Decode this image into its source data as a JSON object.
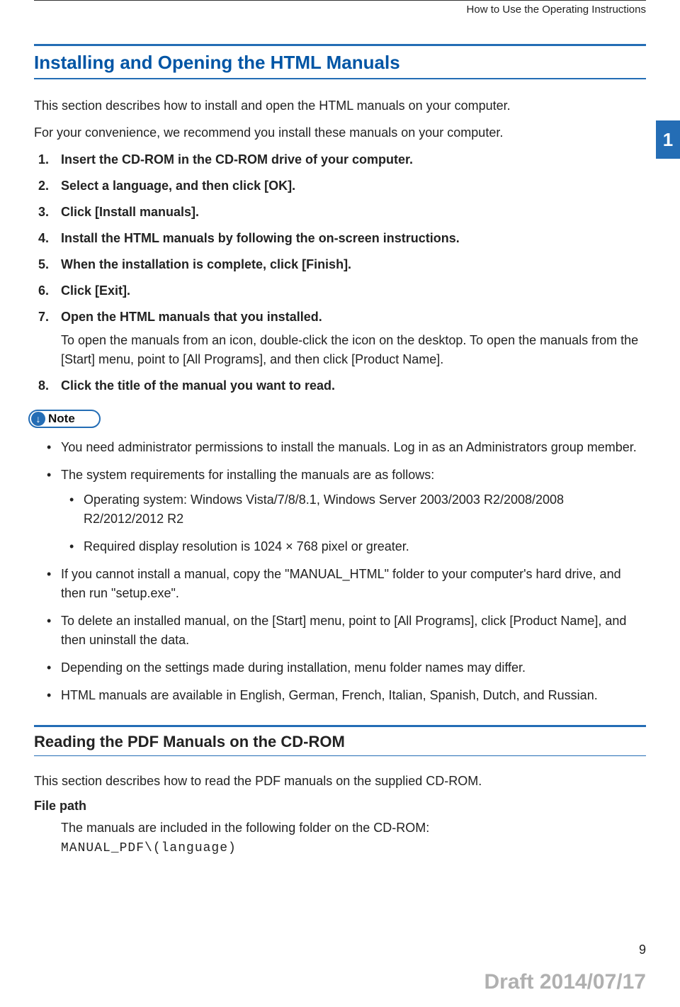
{
  "header": {
    "breadcrumb": "How to Use the Operating Instructions"
  },
  "side_tab": "1",
  "section1": {
    "title": "Installing and Opening the HTML Manuals",
    "intro1": "This section describes how to install and open the HTML manuals on your computer.",
    "intro2": "For your convenience, we recommend you install these manuals on your computer.",
    "steps": [
      {
        "head": "Insert the CD-ROM in the CD-ROM drive of your computer."
      },
      {
        "head": "Select a language, and then click [OK]."
      },
      {
        "head": "Click [Install manuals]."
      },
      {
        "head": "Install the HTML manuals by following the on-screen instructions."
      },
      {
        "head": "When the installation is complete, click [Finish]."
      },
      {
        "head": "Click [Exit]."
      },
      {
        "head": "Open the HTML manuals that you installed.",
        "sub": "To open the manuals from an icon, double-click the icon on the desktop. To open the manuals from the [Start] menu, point to [All Programs], and then click [Product Name]."
      },
      {
        "head": "Click the title of the manual you want to read."
      }
    ],
    "note_label": "Note",
    "notes": [
      {
        "text": "You need administrator permissions to install the manuals. Log in as an Administrators group member."
      },
      {
        "text": "The system requirements for installing the manuals are as follows:",
        "sub": [
          "Operating system: Windows Vista/7/8/8.1, Windows Server 2003/2003 R2/2008/2008 R2/2012/2012 R2",
          "Required display resolution is 1024 × 768 pixel or greater."
        ]
      },
      {
        "text": "If you cannot install a manual, copy the \"MANUAL_HTML\" folder to your computer's hard drive, and then run \"setup.exe\"."
      },
      {
        "text": "To delete an installed manual, on the [Start] menu, point to [All Programs], click [Product Name], and then uninstall the data."
      },
      {
        "text": "Depending on the settings made during installation, menu folder names may differ."
      },
      {
        "text": "HTML manuals are available in English, German, French, Italian, Spanish, Dutch, and Russian."
      }
    ]
  },
  "section2": {
    "title": "Reading the PDF Manuals on the CD-ROM",
    "intro": "This section describes how to read the PDF manuals on the supplied CD-ROM.",
    "filepath_label": "File path",
    "filepath_desc": "The manuals are included in the following folder on the CD-ROM:",
    "filepath_value": "MANUAL_PDF\\(language)"
  },
  "footer": {
    "page_num": "9",
    "draft": "Draft 2014/07/17"
  }
}
